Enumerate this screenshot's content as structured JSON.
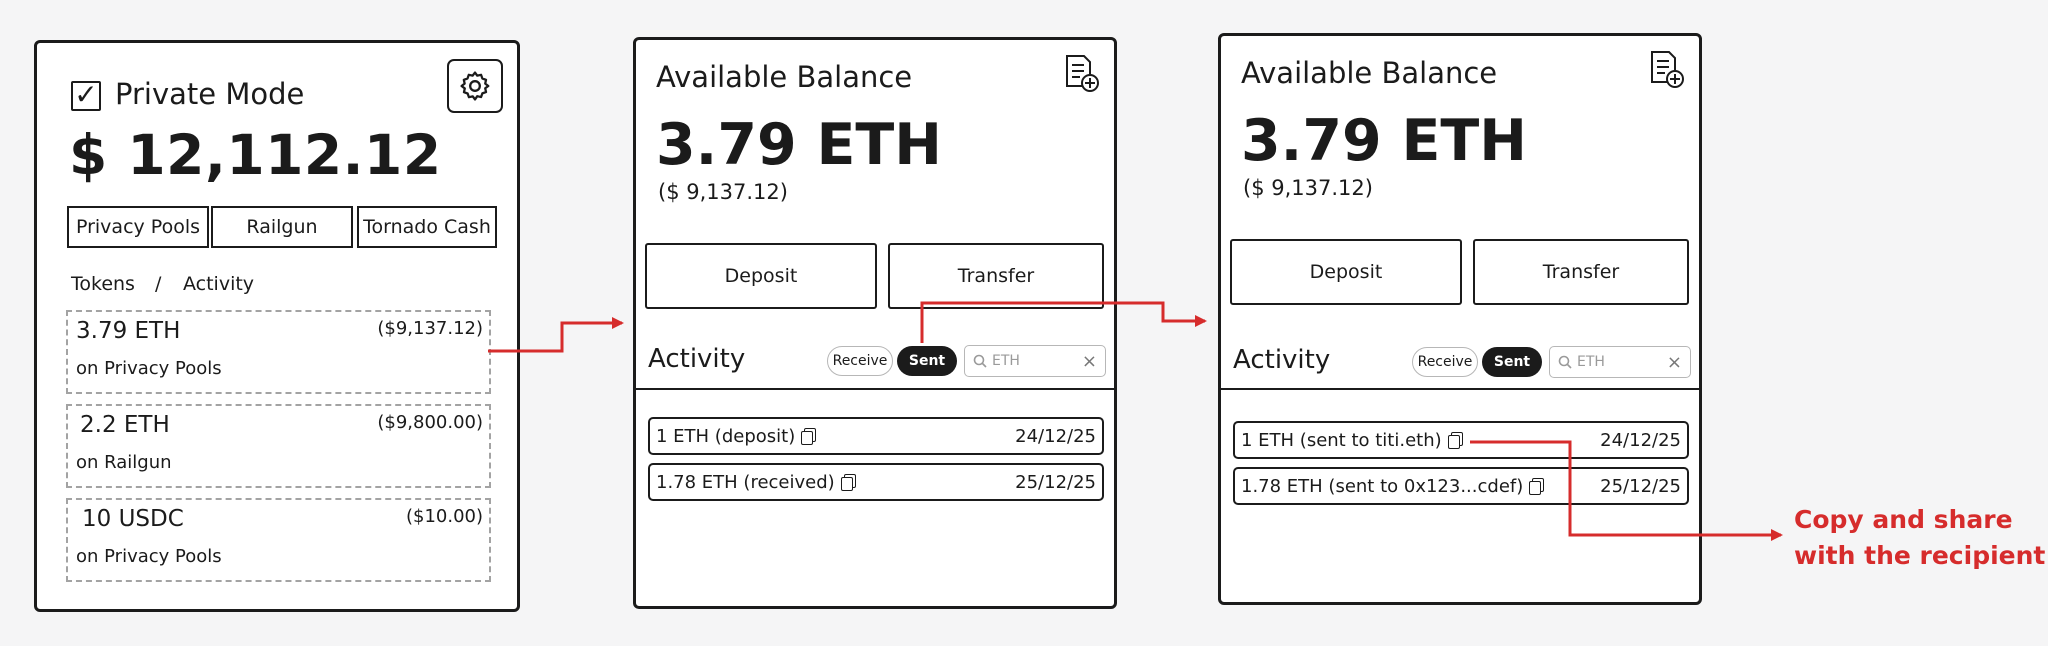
{
  "panel1": {
    "private_mode_label": "Private Mode",
    "checkbox_glyph": "✓",
    "balance": "$ 12,112.12",
    "protocols": [
      "Privacy Pools",
      "Railgun",
      "Tornado Cash"
    ],
    "nav": {
      "tokens": "Tokens",
      "separator": "/",
      "activity": "Activity"
    },
    "tokens": [
      {
        "amount": "3.79 ETH",
        "usd": "($9,137.12)",
        "location": "on Privacy Pools"
      },
      {
        "amount": "2.2 ETH",
        "usd": "($9,800.00)",
        "location": "on Railgun"
      },
      {
        "amount": "10 USDC",
        "usd": "($10.00)",
        "location": "on Privacy Pools"
      }
    ]
  },
  "panel2": {
    "title": "Available Balance",
    "eth_balance": "3.79 ETH",
    "usd_balance": "($ 9,137.12)",
    "deposit_label": "Deposit",
    "transfer_label": "Transfer",
    "activity_title": "Activity",
    "filter_receive": "Receive",
    "filter_sent": "Sent",
    "search_placeholder": "ETH",
    "search_clear": "×",
    "transactions": [
      {
        "label": "1 ETH (deposit)",
        "date": "24/12/25"
      },
      {
        "label": "1.78 ETH (received)",
        "date": "25/12/25"
      }
    ]
  },
  "panel3": {
    "title": "Available Balance",
    "eth_balance": "3.79 ETH",
    "usd_balance": "($ 9,137.12)",
    "deposit_label": "Deposit",
    "transfer_label": "Transfer",
    "activity_title": "Activity",
    "filter_receive": "Receive",
    "filter_sent": "Sent",
    "search_placeholder": "ETH",
    "search_clear": "×",
    "transactions": [
      {
        "label": "1 ETH (sent to titi.eth)",
        "date": "24/12/25"
      },
      {
        "label": "1.78 ETH (sent to 0x123...cdef)",
        "date": "25/12/25"
      }
    ]
  },
  "annotation": {
    "line1": "Copy and share",
    "line2": "with the recipient"
  },
  "colors": {
    "arrow": "#d62c2c",
    "ink": "#1b1b1b",
    "dashed_border": "#a3a3a3",
    "background": "#f5f5f6"
  }
}
